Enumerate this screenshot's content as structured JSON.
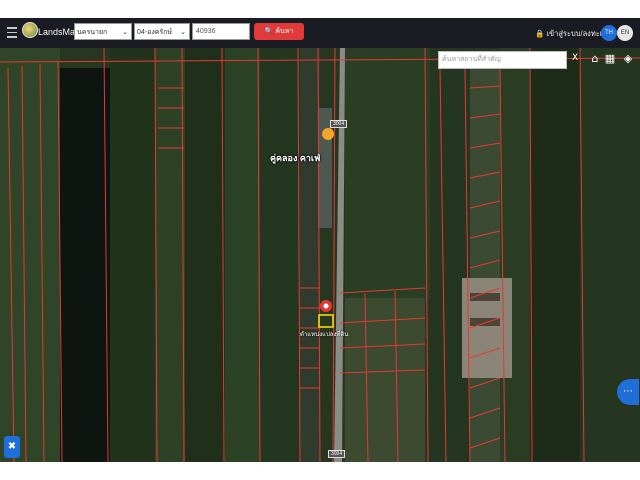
{
  "app": {
    "brand": "LandsMaps"
  },
  "header": {
    "province_select": "นครนายก",
    "district_select": "04-องครักษ์",
    "parcel_number": "40936",
    "search_button": "ค้นหา",
    "login_link": "เข้าสู่ระบบ/ลงทะเบียน",
    "lang_th": "TH",
    "lang_en": "EN"
  },
  "map": {
    "search_placeholder": "ค้นหาสถานที่สำคัญ",
    "close_label": "X",
    "road_label_top": "3004",
    "road_label_bottom": "3004",
    "place_label": "คู่คลอง คาเฟ่",
    "parcel_label": "ตำแหน่งแปลงที่ดิน"
  },
  "colors": {
    "parcel_lines": "#e53935",
    "accent_blue": "#1e6fd9",
    "search_red": "#e23a3a",
    "header_bg": "#1b1c23"
  },
  "icons": {
    "menu": "hamburger-icon",
    "search": "search-icon",
    "layers": "layers-icon",
    "grid": "grid-icon",
    "home": "home-icon",
    "tools": "tools-icon",
    "more": "more-dots-icon",
    "pin": "location-pin-icon"
  }
}
